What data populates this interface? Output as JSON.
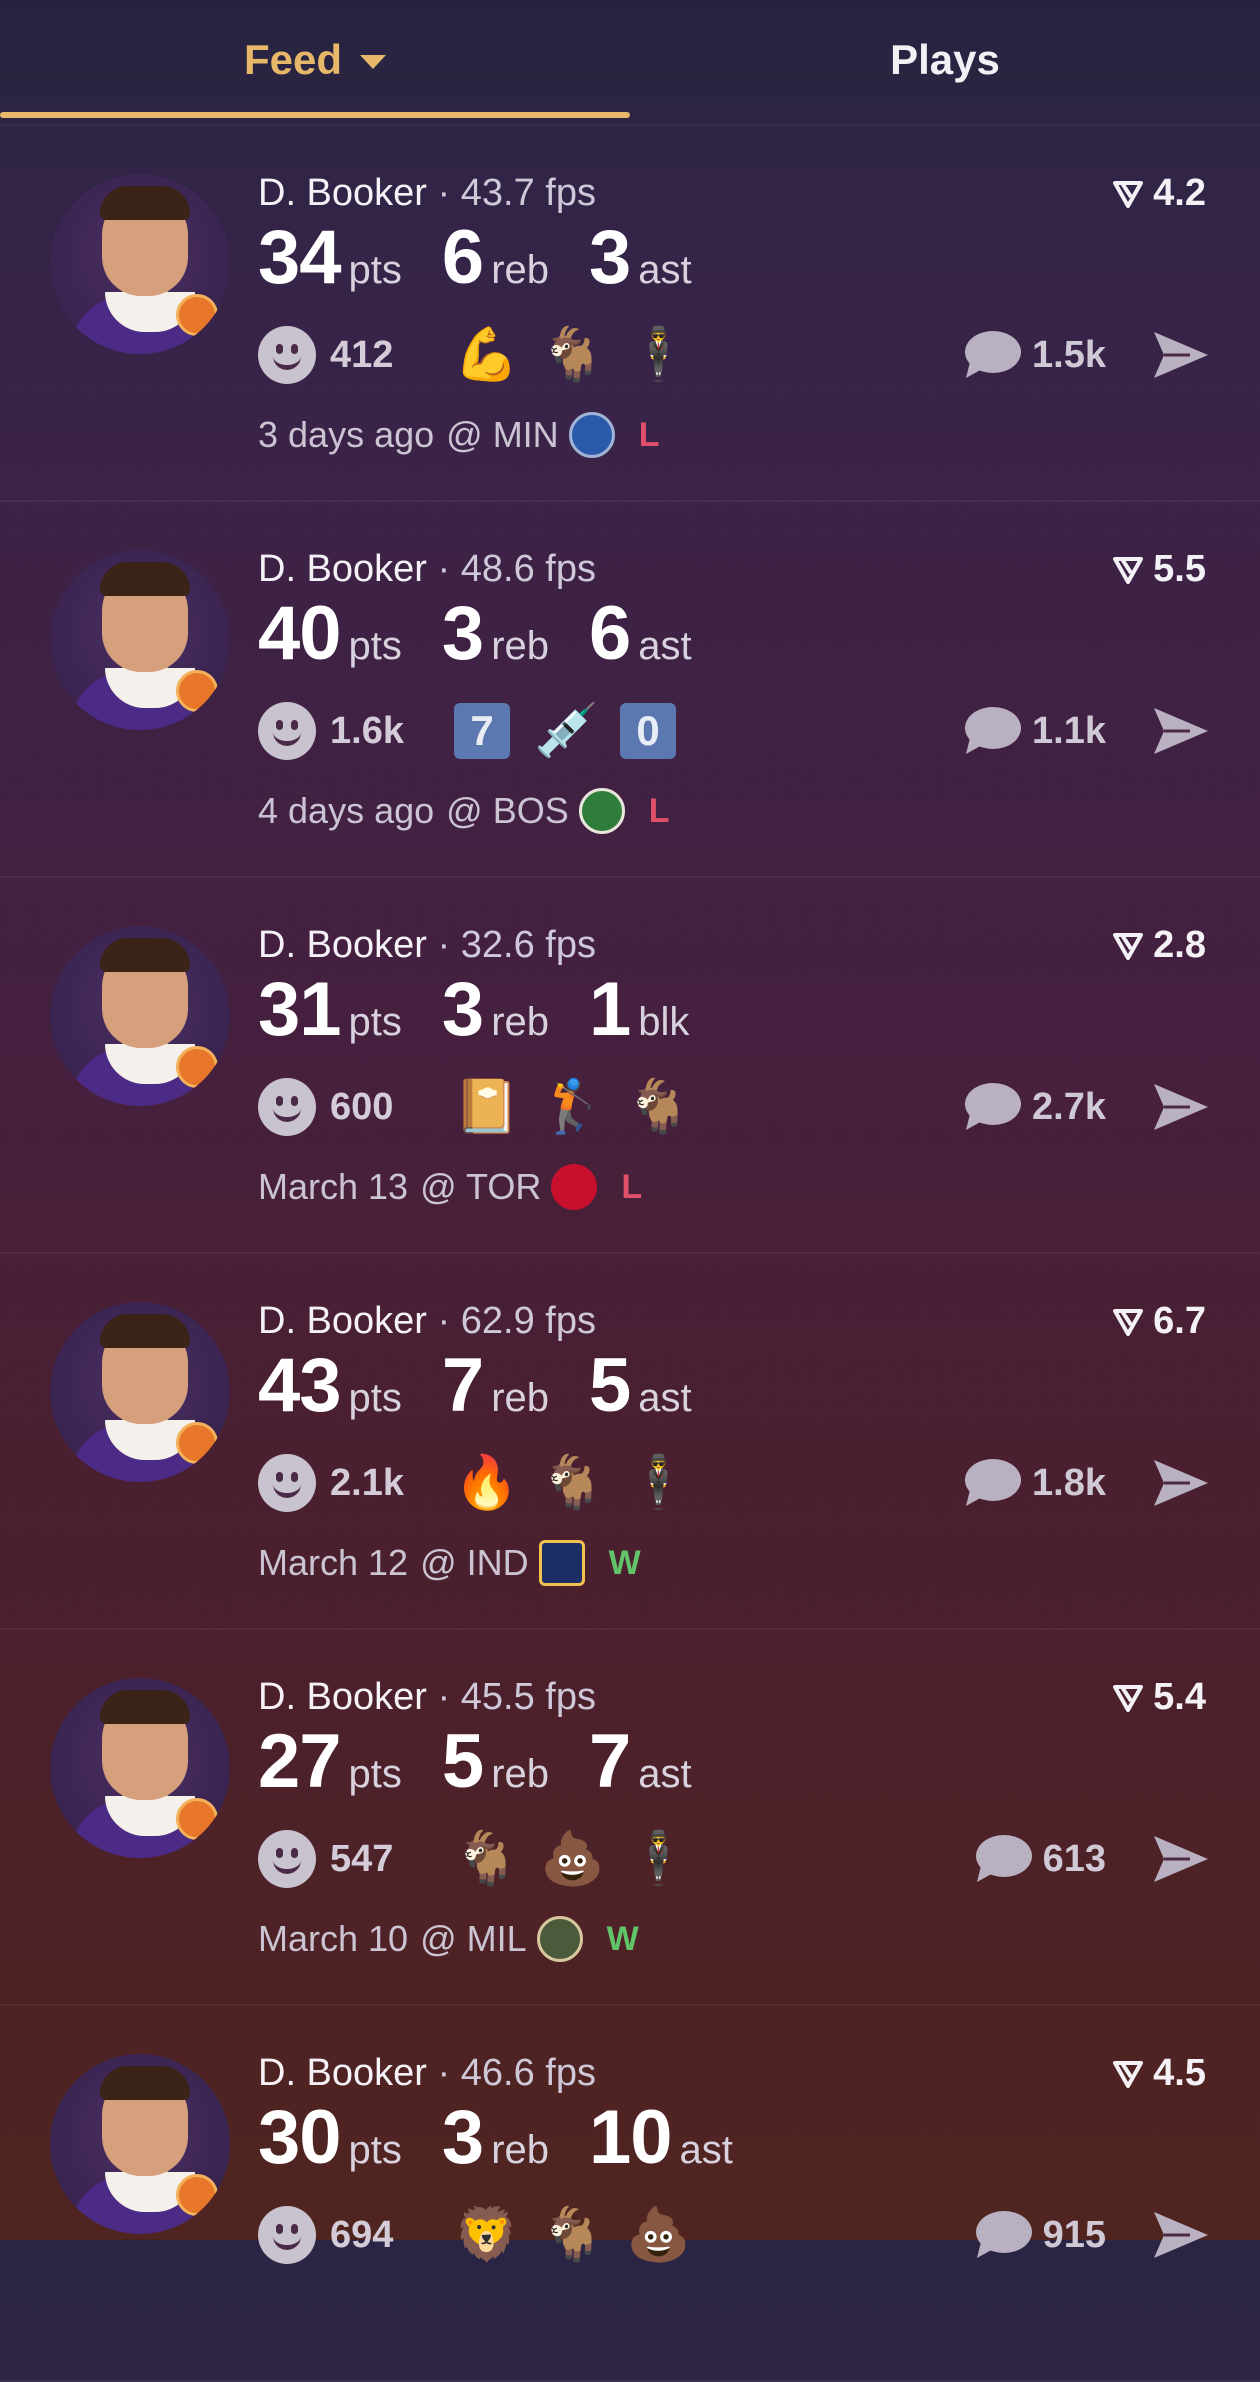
{
  "tabs": {
    "feed_label": "Feed",
    "plays_label": "Plays"
  },
  "colors": {
    "accent": "#e8b86a",
    "loss": "#e0506a",
    "win": "#62c46a"
  },
  "posts": [
    {
      "player": "D. Booker",
      "fps": "43.7 fps",
      "rating": "4.2",
      "stats": [
        {
          "num": "34",
          "label": "pts"
        },
        {
          "num": "6",
          "label": "reb"
        },
        {
          "num": "3",
          "label": "ast"
        }
      ],
      "reaction_count": "412",
      "reactions": [
        "💪",
        "🐐",
        "🕴"
      ],
      "comments": "1.5k",
      "time": "3 days ago",
      "opponent": "@ MIN",
      "team_logo": "wolves-logo",
      "result": "L"
    },
    {
      "player": "D. Booker",
      "fps": "48.6 fps",
      "rating": "5.5",
      "stats": [
        {
          "num": "40",
          "label": "pts"
        },
        {
          "num": "3",
          "label": "reb"
        },
        {
          "num": "6",
          "label": "ast"
        }
      ],
      "reaction_count": "1.6k",
      "reactions": [
        "7",
        "💉",
        "0"
      ],
      "comments": "1.1k",
      "time": "4 days ago",
      "opponent": "@ BOS",
      "team_logo": "celtics-logo",
      "result": "L"
    },
    {
      "player": "D. Booker",
      "fps": "32.6 fps",
      "rating": "2.8",
      "stats": [
        {
          "num": "31",
          "label": "pts"
        },
        {
          "num": "3",
          "label": "reb"
        },
        {
          "num": "1",
          "label": "blk"
        }
      ],
      "reaction_count": "600",
      "reactions": [
        "📔",
        "🏌",
        "🐐"
      ],
      "comments": "2.7k",
      "time": "March 13",
      "opponent": "@ TOR",
      "team_logo": "raptors-logo",
      "result": "L"
    },
    {
      "player": "D. Booker",
      "fps": "62.9 fps",
      "rating": "6.7",
      "stats": [
        {
          "num": "43",
          "label": "pts"
        },
        {
          "num": "7",
          "label": "reb"
        },
        {
          "num": "5",
          "label": "ast"
        }
      ],
      "reaction_count": "2.1k",
      "reactions": [
        "🔥",
        "🐐",
        "🕴"
      ],
      "comments": "1.8k",
      "time": "March 12",
      "opponent": "@ IND",
      "team_logo": "pacers-logo",
      "result": "W"
    },
    {
      "player": "D. Booker",
      "fps": "45.5 fps",
      "rating": "5.4",
      "stats": [
        {
          "num": "27",
          "label": "pts"
        },
        {
          "num": "5",
          "label": "reb"
        },
        {
          "num": "7",
          "label": "ast"
        }
      ],
      "reaction_count": "547",
      "reactions": [
        "🐐",
        "💩",
        "🕴"
      ],
      "comments": "613",
      "time": "March 10",
      "opponent": "@ MIL",
      "team_logo": "bucks-logo",
      "result": "W"
    },
    {
      "player": "D. Booker",
      "fps": "46.6 fps",
      "rating": "4.5",
      "stats": [
        {
          "num": "30",
          "label": "pts"
        },
        {
          "num": "3",
          "label": "reb"
        },
        {
          "num": "10",
          "label": "ast"
        }
      ],
      "reaction_count": "694",
      "reactions": [
        "🦁",
        "🐐",
        "💩"
      ],
      "comments": "915",
      "time": "",
      "opponent": "",
      "team_logo": "",
      "result": ""
    }
  ]
}
